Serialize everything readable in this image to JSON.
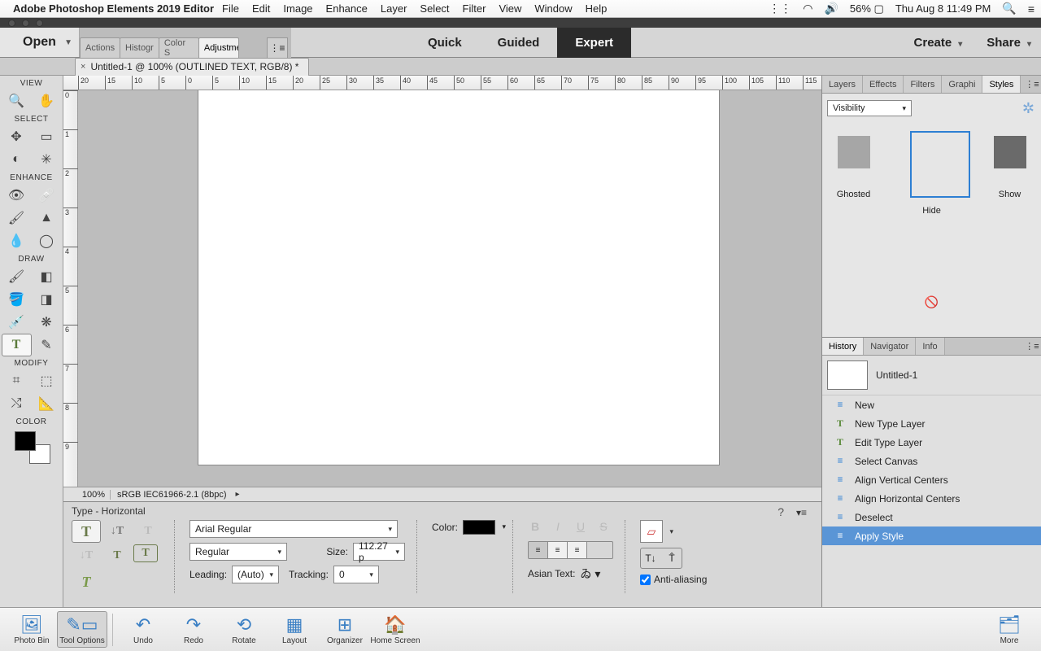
{
  "menubar": {
    "app": "Adobe Photoshop Elements 2019 Editor",
    "items": [
      "File",
      "Edit",
      "Image",
      "Enhance",
      "Layer",
      "Select",
      "Filter",
      "View",
      "Window",
      "Help"
    ],
    "battery": "56%",
    "datetime": "Thu Aug 8  11:49 PM"
  },
  "titlebar": {
    "open": "Open",
    "palette_tabs": [
      "Actions",
      "Histogr",
      "Color S",
      "Adjustments"
    ],
    "active_palette": 3,
    "modes": [
      "Quick",
      "Guided",
      "Expert"
    ],
    "active_mode": 2,
    "create": "Create",
    "share": "Share"
  },
  "document": {
    "tab": "Untitled-1 @ 100% (OUTLINED TEXT, RGB/8) *",
    "zoom": "100%",
    "profile": "sRGB IEC61966-2.1 (8bpc)"
  },
  "toolbox": {
    "sections": {
      "view": "VIEW",
      "select": "SELECT",
      "enhance": "ENHANCE",
      "draw": "DRAW",
      "modify": "MODIFY",
      "color": "COLOR"
    }
  },
  "right": {
    "top_tabs": [
      "Layers",
      "Effects",
      "Filters",
      "Graphi",
      "Styles"
    ],
    "top_active": 4,
    "styles_dropdown": "Visibility",
    "styles": [
      {
        "label": "Ghosted",
        "class": "ghosted"
      },
      {
        "label": "Hide",
        "class": "hide"
      },
      {
        "label": "Show",
        "class": "show"
      }
    ],
    "bottom_tabs": [
      "History",
      "Navigator",
      "Info"
    ],
    "bottom_active": 0,
    "history_doc": "Untitled-1",
    "history": [
      {
        "label": "New",
        "icon": "≡"
      },
      {
        "label": "New Type Layer",
        "icon": "T"
      },
      {
        "label": "Edit Type Layer",
        "icon": "T"
      },
      {
        "label": "Select Canvas",
        "icon": "≡"
      },
      {
        "label": "Align Vertical Centers",
        "icon": "≡"
      },
      {
        "label": "Align Horizontal Centers",
        "icon": "≡"
      },
      {
        "label": "Deselect",
        "icon": "≡"
      },
      {
        "label": "Apply Style",
        "icon": "≡",
        "selected": true
      }
    ]
  },
  "options": {
    "title": "Type - Horizontal",
    "font": "Arial Regular",
    "style": "Regular",
    "leading_label": "Leading:",
    "leading": "(Auto)",
    "size_label": "Size:",
    "size": "112.27 p",
    "tracking_label": "Tracking:",
    "tracking": "0",
    "color_label": "Color:",
    "asian_text": "Asian Text:",
    "anti_alias": "Anti-aliasing"
  },
  "taskbar": {
    "items": [
      "Photo Bin",
      "Tool Options",
      "Undo",
      "Redo",
      "Rotate",
      "Layout",
      "Organizer",
      "Home Screen"
    ],
    "selected": 1,
    "more": "More"
  },
  "ruler_h": [
    -20,
    -15,
    -10,
    -5,
    0,
    5,
    10,
    15,
    20,
    25,
    30,
    35,
    40,
    45,
    50,
    55,
    60,
    65,
    70,
    75,
    80,
    85,
    90,
    95,
    100,
    105,
    110,
    115
  ],
  "ruler_v": [
    0,
    1,
    2,
    3,
    4,
    5,
    6,
    7,
    8,
    9
  ]
}
